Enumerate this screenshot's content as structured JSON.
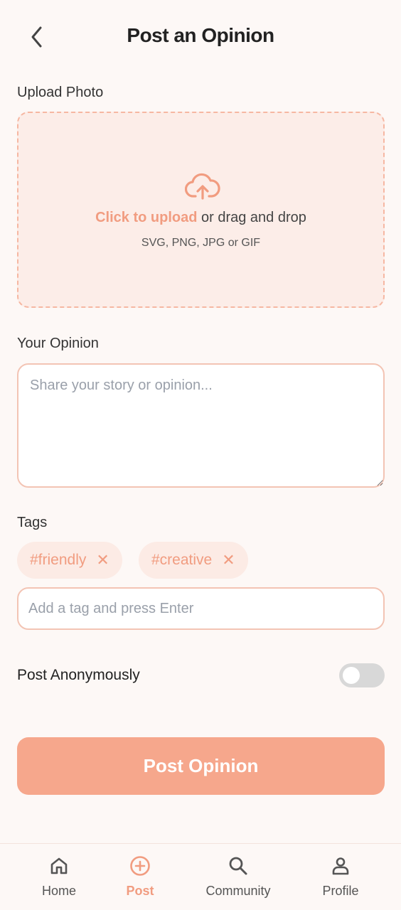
{
  "header": {
    "title": "Post an Opinion",
    "back_icon": "chevron-left-icon"
  },
  "upload": {
    "label": "Upload Photo",
    "link_text": "Click to upload",
    "rest_text": " or drag and drop",
    "hint": "SVG, PNG, JPG or GIF",
    "icon": "cloud-upload-icon"
  },
  "opinion": {
    "label": "Your Opinion",
    "placeholder": "Share your story or opinion...",
    "value": ""
  },
  "tags": {
    "label": "Tags",
    "items": [
      {
        "label": "#friendly",
        "remove_symbol": "✕"
      },
      {
        "label": "#creative",
        "remove_symbol": "✕"
      }
    ],
    "input_placeholder": "Add a tag and press Enter",
    "input_value": ""
  },
  "anonymous": {
    "label": "Post Anonymously",
    "enabled": false
  },
  "submit": {
    "label": "Post Opinion"
  },
  "bottom_nav": {
    "items": [
      {
        "label": "Home",
        "icon": "home-icon"
      },
      {
        "label": "Post",
        "icon": "plus-circle-icon",
        "active": true
      },
      {
        "label": "Community",
        "icon": "search-icon"
      },
      {
        "label": "Profile",
        "icon": "user-icon"
      }
    ]
  },
  "colors": {
    "accent": "#f19c80",
    "button": "#f6a78c",
    "upload_bg": "#fcede8",
    "tag_bg": "#fcebe5",
    "page_bg": "#fdf8f6"
  }
}
